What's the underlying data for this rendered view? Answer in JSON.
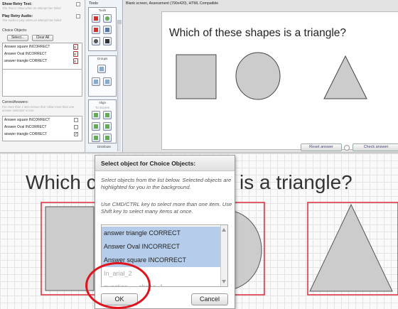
{
  "left_panel": {
    "show_retry_text": {
      "label": "Show Retry Text:",
      "hint": "The Text is show when an attempt has failed"
    },
    "play_retry_audio": {
      "label": "Play Retry Audio:",
      "hint": "The Audio is play when an attempt has failed"
    },
    "choice_objects": {
      "title": "Choice Objects:",
      "select_button": "Select...",
      "clear_button": "Clear All",
      "items": [
        "Answer square INCORRECT",
        "Answer Oval INCORRECT",
        "answer triangle CORRECT"
      ]
    },
    "correct_answers": {
      "title": "CorrectAnswers:",
      "hint": "For more than 1 item ensure that 'Allow more than one answer selection' is true",
      "items": [
        {
          "label": "Answer square INCORRECT",
          "checked": false
        },
        {
          "label": "Answer Oval INCORRECT",
          "checked": false
        },
        {
          "label": "answer triangle CORRECT",
          "checked": true
        }
      ]
    }
  },
  "tools_panel": {
    "title": "Tools",
    "tools_label": "Tools",
    "groups_label": "Groups",
    "align_label": "Align",
    "to_screen_label": "To Screen",
    "distribute_label": "Distribute",
    "icons": [
      "text-icon",
      "image-icon",
      "shape-icon",
      "chart-icon",
      "hide-icon",
      "close-icon",
      "group-icon",
      "ungroup-icon",
      "align-left-icon",
      "align-center-icon",
      "distribute-icon",
      "resize-icon"
    ]
  },
  "canvas": {
    "header": "Blank screen, Assessment (790x420), HTML Compatible",
    "question": "Which of these shapes is a triangle?",
    "reset_button": "Reset answer",
    "check_button": "Check answer"
  },
  "zoom_view": {
    "question_left": "Which c",
    "question_right": "is a triangle?"
  },
  "dialog": {
    "title": "Select object for Choice Objects:",
    "text1": "Select objects from the list below. Selected objects are highlighted for you in the background.",
    "text2": "Use CMD/CTRL key to select more than one item. Use Shift key to select many items at once.",
    "items": [
      {
        "label": "answer triangle CORRECT",
        "selected": true
      },
      {
        "label": "Answer Oval INCORRECT",
        "selected": true
      },
      {
        "label": "Answer square INCORRECT",
        "selected": true
      },
      {
        "label": "In_arial_2",
        "selected": false
      },
      {
        "label": "question_ _ shape_1",
        "selected": false
      }
    ],
    "ok_button": "OK",
    "cancel_button": "Cancel"
  },
  "colors": {
    "highlight_red": "#e0141e",
    "selection_blue": "#b5cdea",
    "shape_fill": "#cccccc"
  }
}
